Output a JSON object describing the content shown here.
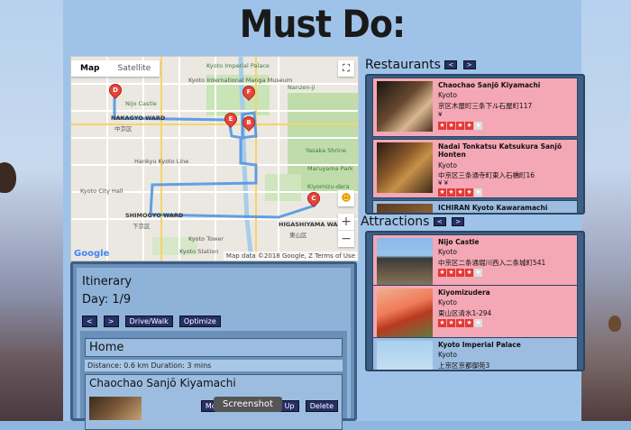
{
  "page": {
    "title": "Must Do:"
  },
  "map": {
    "tabs": [
      "Map",
      "Satellite"
    ],
    "fullscreen_icon": "fullscreen-icon",
    "zoom_in": "+",
    "zoom_out": "−",
    "footer": "Map data ©2018 Google, Z  Terms of Use",
    "google": "Google",
    "labels": [
      "Kyoto International Manga Museum",
      "Nijo Castle",
      "Kyoto Imperial Palace",
      "NAKAGYO WARD",
      "中京区",
      "SHIMOGYO WARD",
      "下京区",
      "HIGASHIYAMA WARD",
      "東山区",
      "Kyoto Station",
      "Yasaka Shrine",
      "Maruyama Park",
      "Kiyomizu-dera",
      "Kyoto Tower",
      "Hankyu Kyoto Line",
      "Kyoto City Hall",
      "Nanzen-ji"
    ],
    "markers": [
      "D",
      "F",
      "E",
      "B",
      "C"
    ]
  },
  "itinerary": {
    "title": "Itinerary",
    "day": "Day: 1/9",
    "prev": "<",
    "next": ">",
    "mode": "Drive/Walk",
    "optimize": "Optimize",
    "stops": [
      {
        "name": "Home",
        "info": "Distance: 0.6 km Duration: 3 mins"
      },
      {
        "name": "Chaochao Sanjō Kiyamachi"
      }
    ],
    "move_down": "Move Down",
    "move_up": "Move Up",
    "delete": "Delete"
  },
  "tooltip": "Screenshot",
  "restaurants": {
    "heading": "Restaurants",
    "prev": "<",
    "next": ">",
    "items": [
      {
        "name": "Chaochao Sanjō Kiyamachi",
        "city": "Kyoto",
        "addr": "京区木屋町三条下ル石屋町117",
        "price": "¥",
        "rating": 4
      },
      {
        "name": "Nadai Tonkatsu Katsukura Sanjō Honten",
        "city": "Kyoto",
        "addr": "中京区三条通寺町東入石橋町16",
        "price": "¥ ¥",
        "rating": 4
      },
      {
        "name": "ICHIRAN Kyoto Kawaramachi"
      }
    ]
  },
  "attractions": {
    "heading": "Attractions",
    "prev": "<",
    "next": ">",
    "items": [
      {
        "name": "Nijo Castle",
        "city": "Kyoto",
        "addr": "中京区二条通堀川西入二条城町541",
        "rating": 4
      },
      {
        "name": "Kiyomizudera",
        "city": "Kyoto",
        "addr": "東山区清水1-294",
        "rating": 4
      },
      {
        "name": "Kyoto Imperial Palace",
        "city": "Kyoto",
        "addr": "上京区京都御苑3"
      }
    ]
  }
}
